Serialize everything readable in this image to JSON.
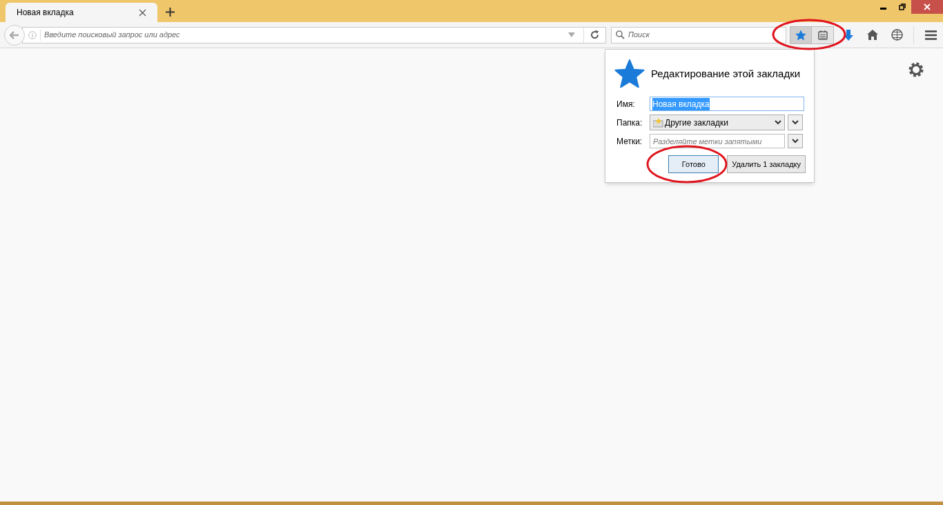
{
  "tabs": [
    {
      "title": "Новая вкладка",
      "selected": true
    }
  ],
  "url_bar": {
    "placeholder": "Введите поисковый запрос или адрес"
  },
  "search_bar": {
    "placeholder": "Поиск"
  },
  "bookmark_button": {
    "pressed": true
  },
  "bookmark_panel": {
    "title": "Редактирование этой закладки",
    "fields": [
      {
        "kind": "text",
        "label": "Имя:",
        "value": "Новая вкладка",
        "highlighted": true
      },
      {
        "kind": "select",
        "label": "Папка:",
        "value": "Другие закладки"
      },
      {
        "kind": "tags",
        "label": "Метки:",
        "placeholder": "Разделяйте метки запятыми"
      }
    ],
    "buttons": [
      {
        "label": "Готово",
        "default": true
      },
      {
        "label": "Удалить 1 закладку",
        "default": false
      }
    ]
  }
}
